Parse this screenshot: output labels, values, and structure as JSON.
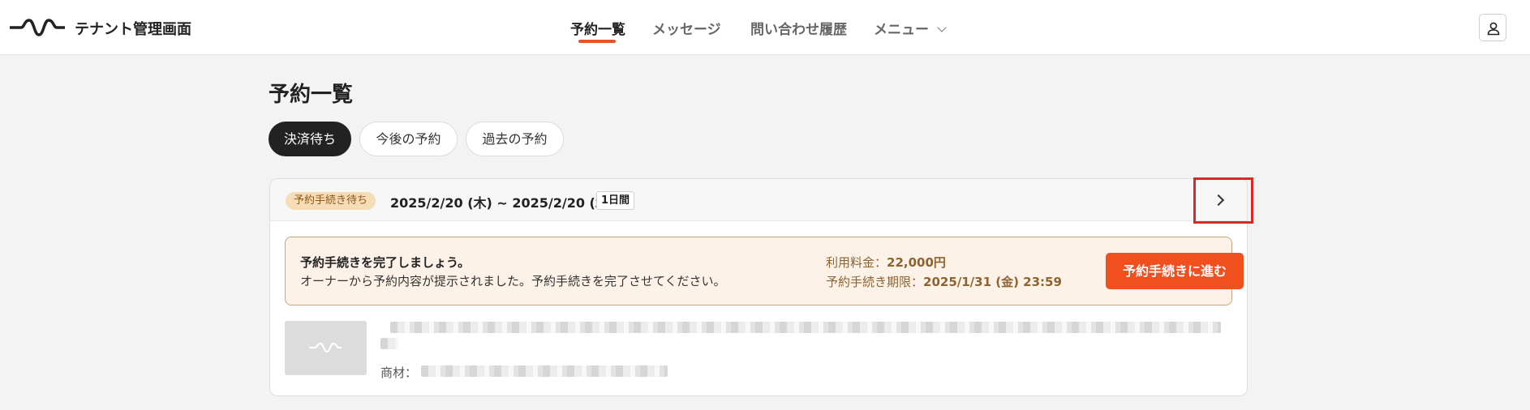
{
  "header": {
    "app_title": "テナント管理画面",
    "nav": [
      {
        "label": "予約一覧",
        "active": true
      },
      {
        "label": "メッセージ",
        "active": false
      },
      {
        "label": "問い合わせ履歴",
        "active": false
      },
      {
        "label": "メニュー",
        "active": false,
        "has_dropdown": true
      }
    ],
    "logo_icon": "wave-logo-icon",
    "user_icon": "user-icon"
  },
  "page": {
    "title": "予約一覧",
    "tabs": [
      {
        "label": "決済待ち",
        "active": true
      },
      {
        "label": "今後の予約",
        "active": false
      },
      {
        "label": "過去の予約",
        "active": false
      }
    ]
  },
  "reservation": {
    "status_badge": "予約手続き待ち",
    "date_range": "2025/2/20 (木) ~ 2025/2/20 (木)",
    "duration": "1日間",
    "notice": {
      "title": "予約手続きを完了しましょう。",
      "body": "オーナーから予約内容が提示されました。予約手続きを完了させてください。",
      "fee_label": "利用料金：",
      "fee_value": "22,000円",
      "deadline_label": "予約手続き期限：",
      "deadline_value": "2025/1/31 (金) 23:59",
      "button_label": "予約手続きに進む"
    },
    "material_label": "商材："
  },
  "colors": {
    "accent": "#f24f1e",
    "nav_underline": "#f0502a",
    "badge_bg": "#f7dcb8",
    "notice_bg": "#fdf2e8",
    "highlight": "#d62b2b"
  }
}
